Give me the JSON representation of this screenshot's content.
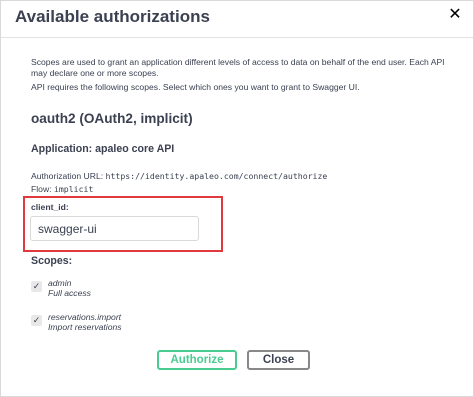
{
  "dialog": {
    "title": "Available authorizations",
    "close_glyph": "✕"
  },
  "description": {
    "line1": "Scopes are used to grant an application different levels of access to data on behalf of the end user. Each API may declare one or more scopes.",
    "line2": "API requires the following scopes. Select which ones you want to grant to Swagger UI."
  },
  "scheme": {
    "title": "oauth2 (OAuth2, implicit)",
    "application": "Application: apaleo core API",
    "auth_url_label": "Authorization URL:",
    "auth_url": "https://identity.apaleo.com/connect/authorize",
    "flow_label": "Flow:",
    "flow": "implicit"
  },
  "client": {
    "label": "client_id:",
    "value": "swagger-ui"
  },
  "scopes": {
    "title": "Scopes:",
    "items": [
      {
        "name": "admin",
        "description": "Full access",
        "checked": true
      },
      {
        "name": "reservations.import",
        "description": "Import reservations",
        "checked": true
      }
    ]
  },
  "buttons": {
    "authorize": "Authorize",
    "close": "Close"
  },
  "colors": {
    "authorize_green": "#49cc90",
    "highlight_red": "#e0393e",
    "text": "#3b4151"
  }
}
